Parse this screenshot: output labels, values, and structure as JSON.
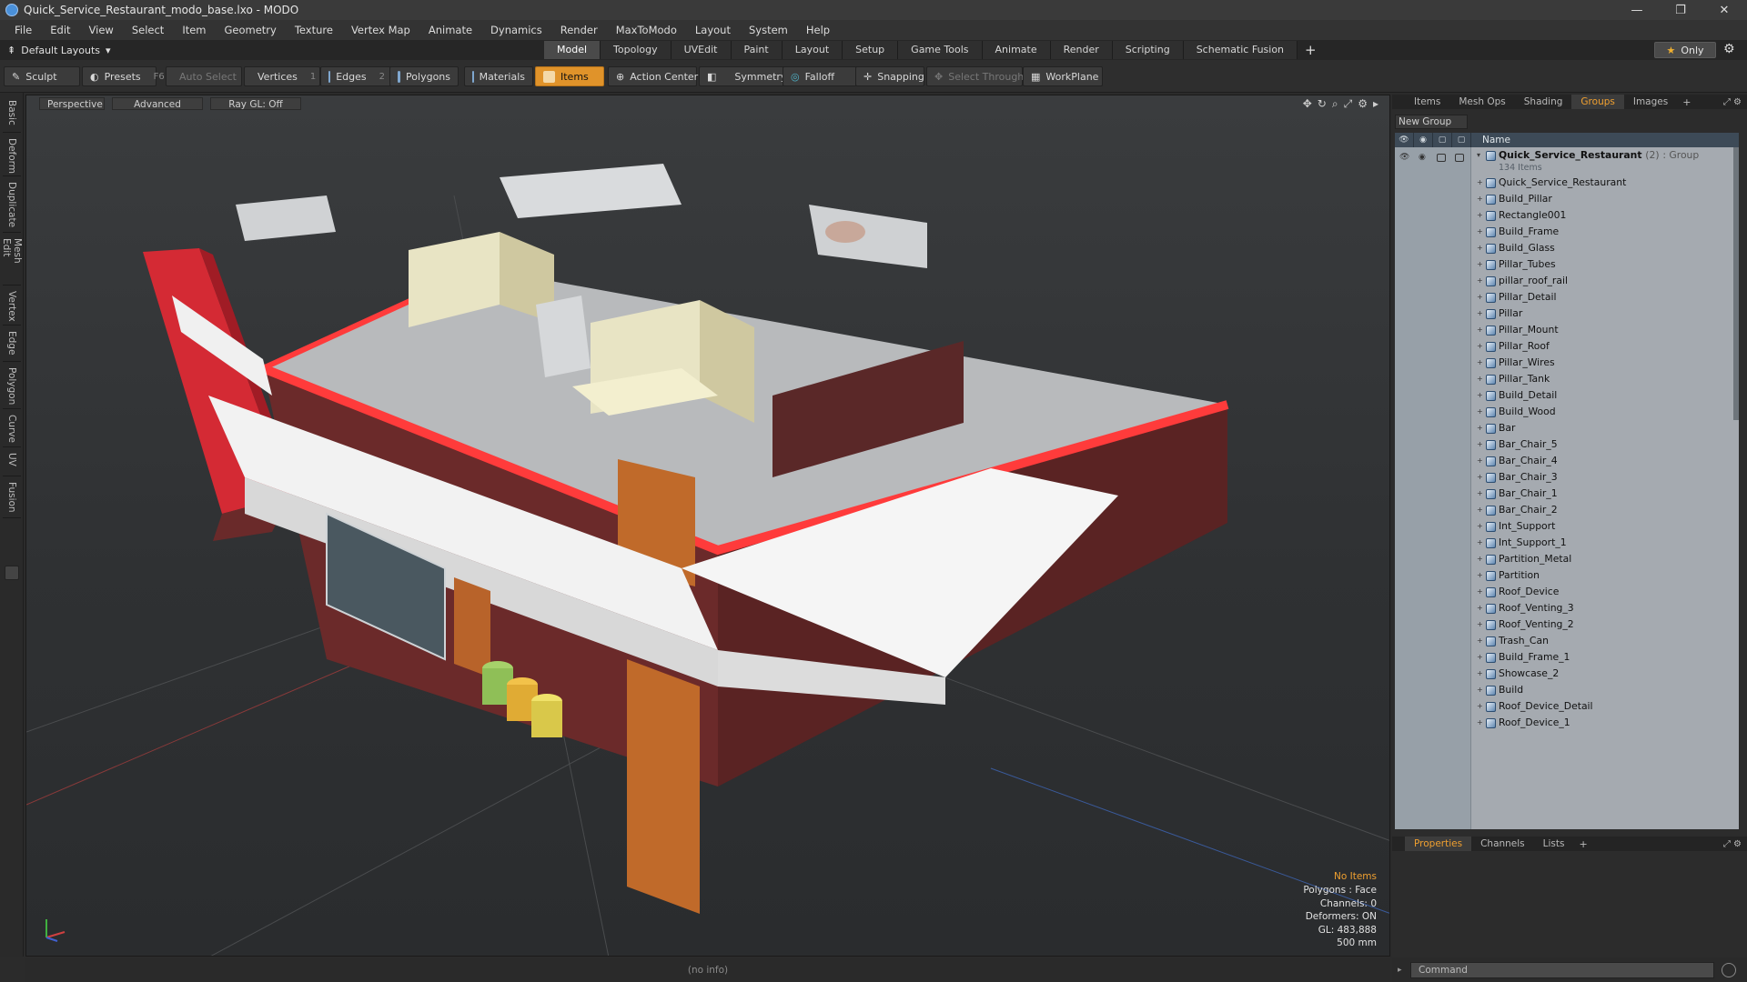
{
  "window": {
    "title": "Quick_Service_Restaurant_modo_base.lxo - MODO",
    "minimize": "—",
    "restore": "❐",
    "close": "✕"
  },
  "menu": [
    "File",
    "Edit",
    "View",
    "Select",
    "Item",
    "Geometry",
    "Texture",
    "Vertex Map",
    "Animate",
    "Dynamics",
    "Render",
    "MaxToModo",
    "Layout",
    "System",
    "Help"
  ],
  "layoutbar": {
    "layout_label": "Default Layouts",
    "tabs": [
      "Model",
      "Topology",
      "UVEdit",
      "Paint",
      "Layout",
      "Setup",
      "Game Tools",
      "Animate",
      "Render",
      "Scripting",
      "Schematic Fusion"
    ],
    "active_tab": "Model",
    "plus": "+",
    "only_label": "Only"
  },
  "toolbar": {
    "sculpt": "Sculpt",
    "presets": "Presets",
    "presets_key": "F6",
    "auto_select": "Auto Select",
    "vertices": "Vertices",
    "vertices_count": "1",
    "edges": "Edges",
    "edges_count": "2",
    "polygons": "Polygons",
    "materials": "Materials",
    "items": "Items",
    "action_center": "Action Center",
    "symmetry": "Symmetry",
    "falloff": "Falloff",
    "snapping": "Snapping",
    "select_through": "Select Through",
    "workplane": "WorkPlane"
  },
  "left_tabs": [
    "Basic",
    "Deform",
    "Duplicate",
    "Mesh Edit",
    "Vertex",
    "Edge",
    "Polygon",
    "Curve",
    "UV",
    "Fusion"
  ],
  "viewport": {
    "view_mode": "Perspective",
    "shading": "Advanced",
    "raygl": "Ray GL: Off",
    "info": {
      "items": "No Items",
      "polygons": "Polygons : Face",
      "channels": "Channels: 0",
      "deformers": "Deformers: ON",
      "gl": "GL: 483,888",
      "scale": "500 mm"
    }
  },
  "right_panel": {
    "tabs": [
      "Items",
      "Mesh Ops",
      "Shading",
      "Groups",
      "Images"
    ],
    "active_tab": "Groups",
    "new_group": "New Group",
    "tree_header": "Name",
    "group": {
      "name": "Quick_Service_Restaurant",
      "count": "(2)",
      "type": ": Group",
      "items_count": "134 Items"
    },
    "items": [
      "Quick_Service_Restaurant",
      "Build_Pillar",
      "Rectangle001",
      "Build_Frame",
      "Build_Glass",
      "Pillar_Tubes",
      "pillar_roof_rail",
      "Pillar_Detail",
      "Pillar",
      "Pillar_Mount",
      "Pillar_Roof",
      "Pillar_Wires",
      "Pillar_Tank",
      "Build_Detail",
      "Build_Wood",
      "Bar",
      "Bar_Chair_5",
      "Bar_Chair_4",
      "Bar_Chair_3",
      "Bar_Chair_1",
      "Bar_Chair_2",
      "Int_Support",
      "Int_Support_1",
      "Partition_Metal",
      "Partition",
      "Roof_Device",
      "Roof_Venting_3",
      "Roof_Venting_2",
      "Trash_Can",
      "Build_Frame_1",
      "Showcase_2",
      "Build",
      "Roof_Device_Detail",
      "Roof_Device_1"
    ],
    "lower_tabs": [
      "Properties",
      "Channels",
      "Lists"
    ],
    "lower_active": "Properties"
  },
  "status": {
    "info": "(no info)"
  },
  "command": {
    "placeholder": "Command"
  },
  "colors": {
    "accent": "#e0932a",
    "brand_red": "#d42a34",
    "wall": "#6b2a2a",
    "roof": "#b8babc",
    "awning": "#f2f2f2"
  }
}
